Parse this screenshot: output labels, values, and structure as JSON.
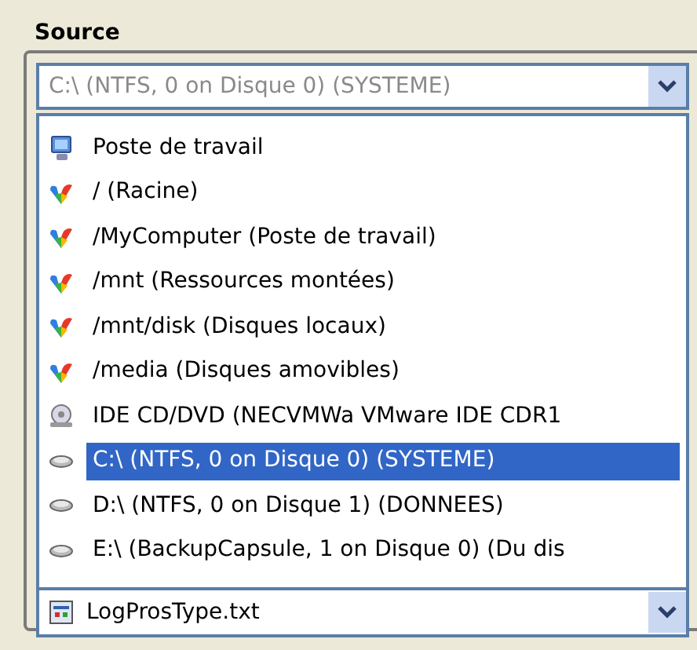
{
  "section_title": "Source",
  "source_combo": {
    "value": "C:\\  (NTFS, 0 on Disque 0) (SYSTEME)"
  },
  "dropdown_items": [
    {
      "kind": "computer",
      "label": "Poste de travail",
      "selected": false
    },
    {
      "kind": "folder",
      "label": "/ (Racine)",
      "selected": false
    },
    {
      "kind": "folder",
      "label": "/MyComputer (Poste de travail)",
      "selected": false
    },
    {
      "kind": "folder",
      "label": "/mnt (Ressources montées)",
      "selected": false
    },
    {
      "kind": "folder",
      "label": "/mnt/disk (Disques locaux)",
      "selected": false
    },
    {
      "kind": "folder",
      "label": "/media (Disques amovibles)",
      "selected": false
    },
    {
      "kind": "cdrom",
      "label": "IDE CD/DVD (NECVMWa VMware IDE CDR1",
      "selected": false
    },
    {
      "kind": "drive",
      "label": "C:\\  (NTFS, 0 on Disque 0) (SYSTEME)",
      "selected": true
    },
    {
      "kind": "drive",
      "label": "D:\\  (NTFS, 0 on Disque 1) (DONNEES)",
      "selected": false
    },
    {
      "kind": "drive",
      "label": "E:\\  (BackupCapsule, 1 on Disque 0) (Du dis",
      "selected": false
    }
  ],
  "file_combo": {
    "value": "LogProsType.txt"
  }
}
